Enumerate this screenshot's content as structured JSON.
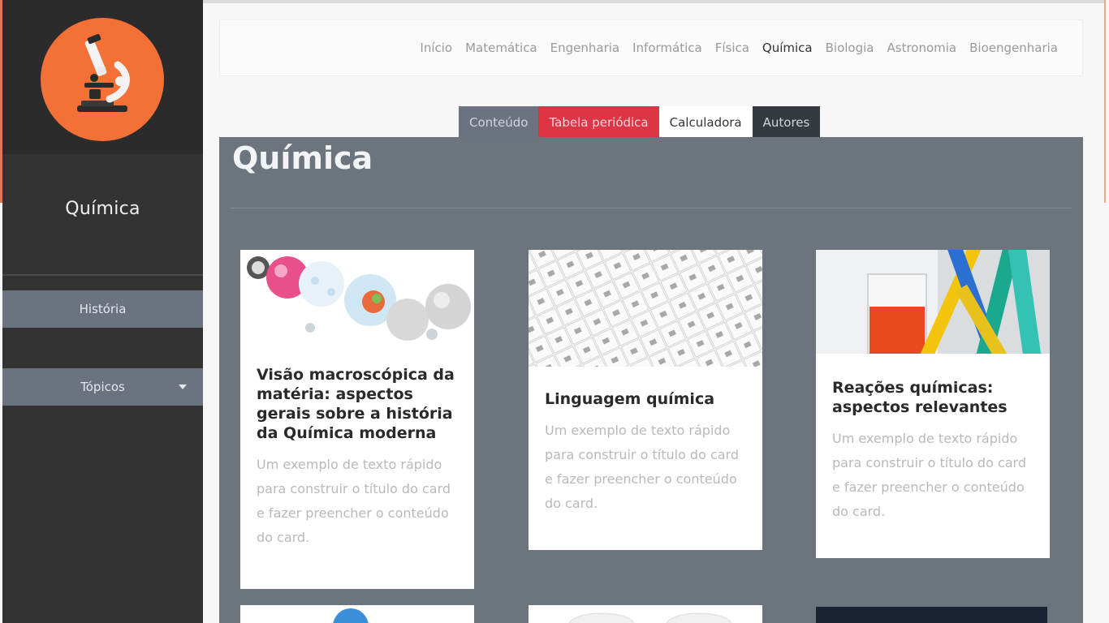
{
  "sidebar": {
    "title": "Química",
    "items": [
      {
        "label": "História"
      },
      {
        "label": "Tópicos"
      }
    ]
  },
  "navbar": {
    "links": [
      {
        "label": "Início"
      },
      {
        "label": "Matemática"
      },
      {
        "label": "Engenharia"
      },
      {
        "label": "Informática"
      },
      {
        "label": "Física"
      },
      {
        "label": "Química"
      },
      {
        "label": "Biologia"
      },
      {
        "label": "Astronomia"
      },
      {
        "label": "Bioengenharia"
      }
    ]
  },
  "tabs": [
    {
      "label": "Conteúdo"
    },
    {
      "label": "Tabela periódica"
    },
    {
      "label": "Calculadora"
    },
    {
      "label": "Autores"
    }
  ],
  "panel": {
    "title": "Química"
  },
  "cards": [
    {
      "title": "Visão macroscópica da matéria: aspectos gerais sobre a história da Química moderna",
      "text": "Um exemplo de texto rápido para construir o título do card e fazer preencher o conteúdo do card."
    },
    {
      "title": "Linguagem química",
      "text": "Um exemplo de texto rápido para construir o título do card e fazer preencher o conteúdo do card."
    },
    {
      "title": "Reações químicas: aspectos relevantes",
      "text": "Um exemplo de texto rápido para construir o título do card e fazer preencher o conteúdo do card."
    }
  ],
  "colors": {
    "logo": "#f37137",
    "sidebar": "#333333",
    "panel": "#6c757d",
    "tab_red": "#dc3545",
    "tab_dark": "#343a40"
  }
}
